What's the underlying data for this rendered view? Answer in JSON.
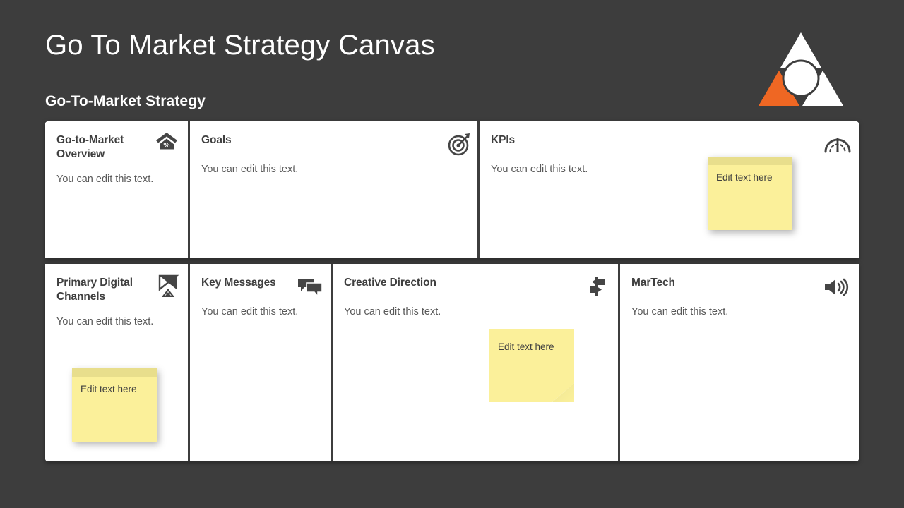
{
  "header": {
    "title": "Go To Market Strategy Canvas",
    "subtitle": "Go-To-Market Strategy"
  },
  "logo": {
    "name": "triangle-circle-logo",
    "accent_color": "#ef6723",
    "fill_color": "#ffffff"
  },
  "colors": {
    "background": "#3d3d3d",
    "card": "#ffffff",
    "title_text": "#ffffff",
    "heading_text": "#3f3f3f",
    "body_text": "#595959",
    "sticky": "#fbf09a",
    "sticky_strip": "#e8de8c",
    "accent": "#ef6723"
  },
  "canvas": {
    "rows": [
      {
        "cells": [
          {
            "title": "Go-to-Market Overview",
            "body": "You can edit this text.",
            "icon": "house-percent-icon",
            "sticky": null
          },
          {
            "title": "Goals",
            "body": "You can edit this text.",
            "icon": "target-arrow-icon",
            "sticky": null
          },
          {
            "title": "KPIs",
            "body": "You can edit this text.",
            "icon": "speedometer-icon",
            "sticky": "Edit text here"
          }
        ]
      },
      {
        "cells": [
          {
            "title": "Primary Digital Channels",
            "body": "You can edit this text.",
            "icon": "satellite-dish-icon",
            "sticky": "Edit text here"
          },
          {
            "title": "Key Messages",
            "body": "You can edit this text.",
            "icon": "speech-bubbles-icon",
            "sticky": null
          },
          {
            "title": "Creative Direction",
            "body": "You can edit this text.",
            "icon": "signpost-icon",
            "sticky": "Edit text here"
          },
          {
            "title": "MarTech",
            "body": "You can edit this text.",
            "icon": "speaker-icon",
            "sticky": null
          }
        ]
      }
    ]
  }
}
